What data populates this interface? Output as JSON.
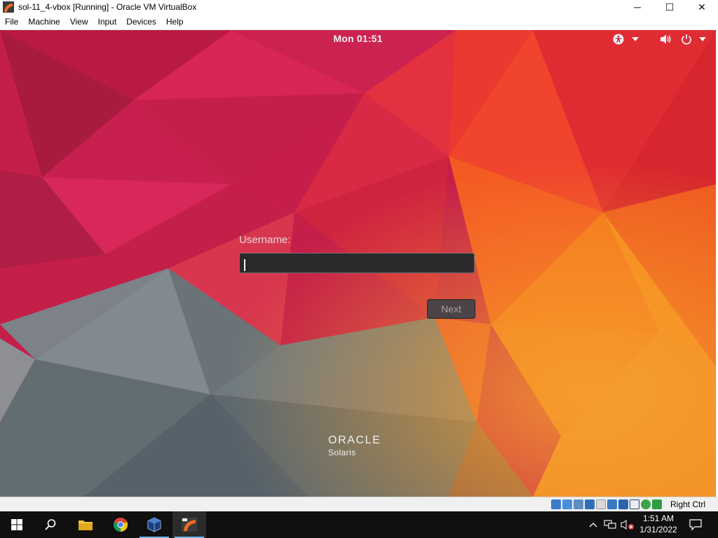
{
  "window": {
    "title": "sol-11_4-vbox [Running] - Oracle VM VirtualBox",
    "controls": {
      "minimize": "─",
      "maximize": "☐",
      "close": "✕"
    }
  },
  "menubar": {
    "items": [
      "File",
      "Machine",
      "View",
      "Input",
      "Devices",
      "Help"
    ]
  },
  "guest": {
    "topbar": {
      "clock": "Mon 01:51",
      "icons": [
        "accessibility-icon",
        "dropdown-arrow-icon",
        "volume-icon",
        "power-icon",
        "dropdown-arrow-icon"
      ]
    },
    "login": {
      "username_label": "Username:",
      "username_value": "",
      "next_label": "Next"
    },
    "branding": {
      "brand": "ORACLE",
      "product": "Solaris"
    }
  },
  "vbox_status": {
    "icons": [
      "hard-disk-icon",
      "optical-drive-icon",
      "audio-icon",
      "network-icon",
      "usb-icon",
      "shared-folders-icon",
      "display-icon",
      "recording-icon",
      "vt-x-icon",
      "cpu-icon",
      "mouse-integration-icon"
    ],
    "host_key": "Right Ctrl"
  },
  "taskbar": {
    "apps": [
      "start-icon",
      "search-icon",
      "file-explorer-icon",
      "chrome-icon",
      "virtualbox-icon",
      "solaris-vm-icon"
    ],
    "tray": {
      "time": "1:51 AM",
      "date": "1/31/2022"
    }
  },
  "colors": {
    "guest_red": "#c21f4a",
    "guest_orange": "#f06a1e",
    "guest_gray": "#5e6a70",
    "taskbar": "#101010"
  }
}
